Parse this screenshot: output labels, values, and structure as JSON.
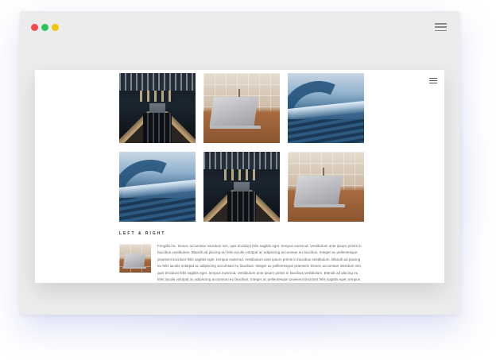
{
  "window": {
    "dots": [
      {
        "name": "close",
        "color": "#ef4b4f"
      },
      {
        "name": "minimize",
        "color": "#2ec45a"
      },
      {
        "name": "maximize",
        "color": "#f1c40f"
      }
    ],
    "menu_icon": "hamburger-icon"
  },
  "page": {
    "menu_icon": "hamburger-icon",
    "gallery": [
      {
        "image": "escalator-photo"
      },
      {
        "image": "laptop-photo"
      },
      {
        "image": "wave-photo"
      },
      {
        "image": "wave-photo"
      },
      {
        "image": "escalator-photo"
      },
      {
        "image": "laptop-photo"
      }
    ],
    "section": {
      "title": "LEFT & RIGHT",
      "image": "laptop-photo",
      "paragraph": "Fringilla hic. Donec accumsan interdum nisi, quis tincidunt felis sagittis eget. tempus euismod. Vestibulum ante ipsum primis in faucibus vestibulum. Blandit ad placing eu felis iaculis volutpat ac adipiscing accumsan eu faucibus. Integer ac pellentesque praesent tincidunt felis sagittis eget. tempus euismod. Vestibulum ante ipsum primis in faucibus vestibulum. Blandit ad placing eu felis iaculis volutpat ac adipiscing accumsan eu faucibus. Integer ac pellentesque praesent. Donec accumsan interdum nisi, quis tincidunt felis sagittis eget. tempus euismod. Vestibulum ante ipsum primis in faucibus vestibulum. Blandit ad placing eu felis iaculis volutpat ac adipiscing accumsan eu faucibus. Integer ac pellentesque praesent tincidunt felis sagittis eget. tempus euismod."
    }
  }
}
